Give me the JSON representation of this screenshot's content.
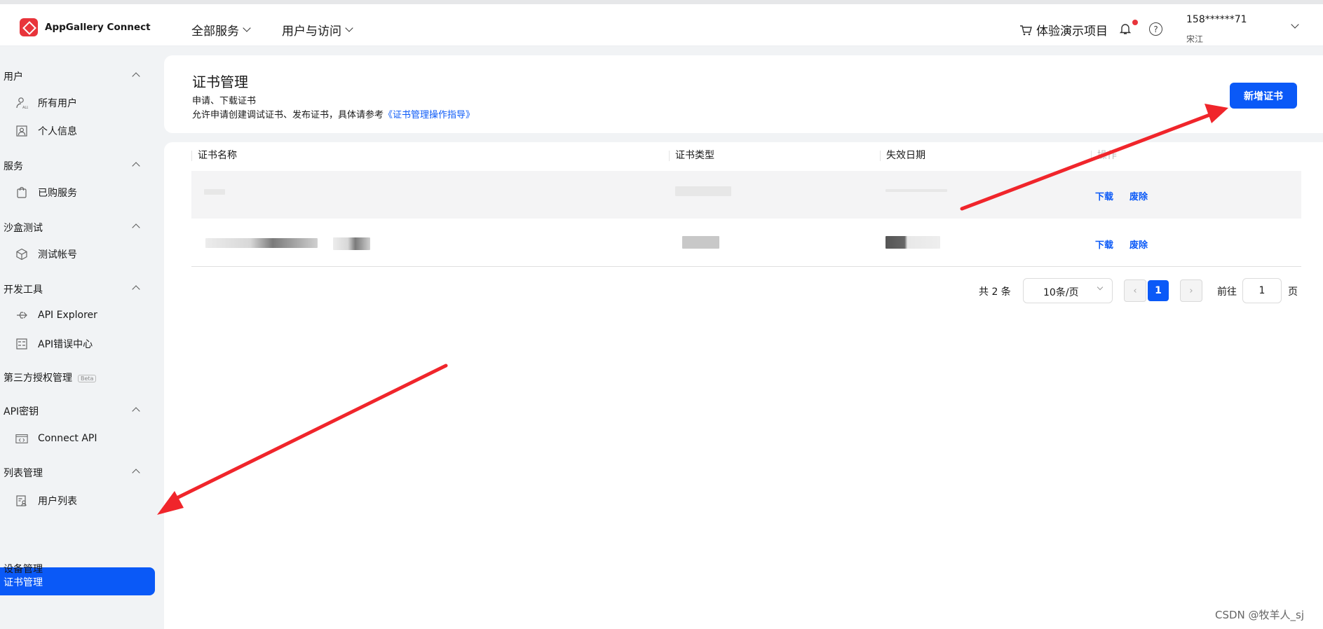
{
  "brand": {
    "name": "AppGallery Connect"
  },
  "topnav": [
    {
      "label": "全部服务"
    },
    {
      "label": "用户与访问"
    }
  ],
  "header_right": {
    "demo_label": "体验演示项目",
    "user_id": "158******71",
    "user_name": "宋江"
  },
  "sidebar": {
    "groups": [
      {
        "label": "用户",
        "items": [
          {
            "label": "所有用户"
          },
          {
            "label": "个人信息"
          }
        ]
      },
      {
        "label": "服务",
        "items": [
          {
            "label": "已购服务"
          }
        ]
      },
      {
        "label": "沙盒测试",
        "items": [
          {
            "label": "测试帐号"
          }
        ]
      },
      {
        "label": "开发工具",
        "items": [
          {
            "label": "API Explorer"
          },
          {
            "label": "API错误中心"
          }
        ]
      },
      {
        "label": "第三方授权管理",
        "badge": "Beta"
      },
      {
        "label": "API密钥",
        "items": [
          {
            "label": "Connect API"
          }
        ]
      },
      {
        "label": "列表管理",
        "items": [
          {
            "label": "用户列表"
          }
        ]
      }
    ],
    "active": "证书管理",
    "last": "设备管理"
  },
  "main": {
    "title": "证书管理",
    "subtitle": "申请、下载证书",
    "desc_prefix": "允许申请创建调试证书、发布证书，具体请参考",
    "desc_link": "《证书管理操作指导》",
    "add_button": "新增证书"
  },
  "table": {
    "columns": [
      "证书名称",
      "证书类型",
      "失效日期",
      "操作"
    ],
    "rows": [
      {
        "actions": [
          "下载",
          "废除"
        ]
      },
      {
        "actions": [
          "下载",
          "废除"
        ]
      }
    ]
  },
  "pagination": {
    "total": "共 2 条",
    "page_size": "10条/页",
    "current_page": "1",
    "goto_label": "前往",
    "goto_value": "1",
    "page_suffix": "页"
  },
  "watermark": "CSDN @牧羊人_sj",
  "colors": {
    "accent": "#0a59f7",
    "brand_red": "#e8343b",
    "annotation_arrow": "#f0252b"
  }
}
